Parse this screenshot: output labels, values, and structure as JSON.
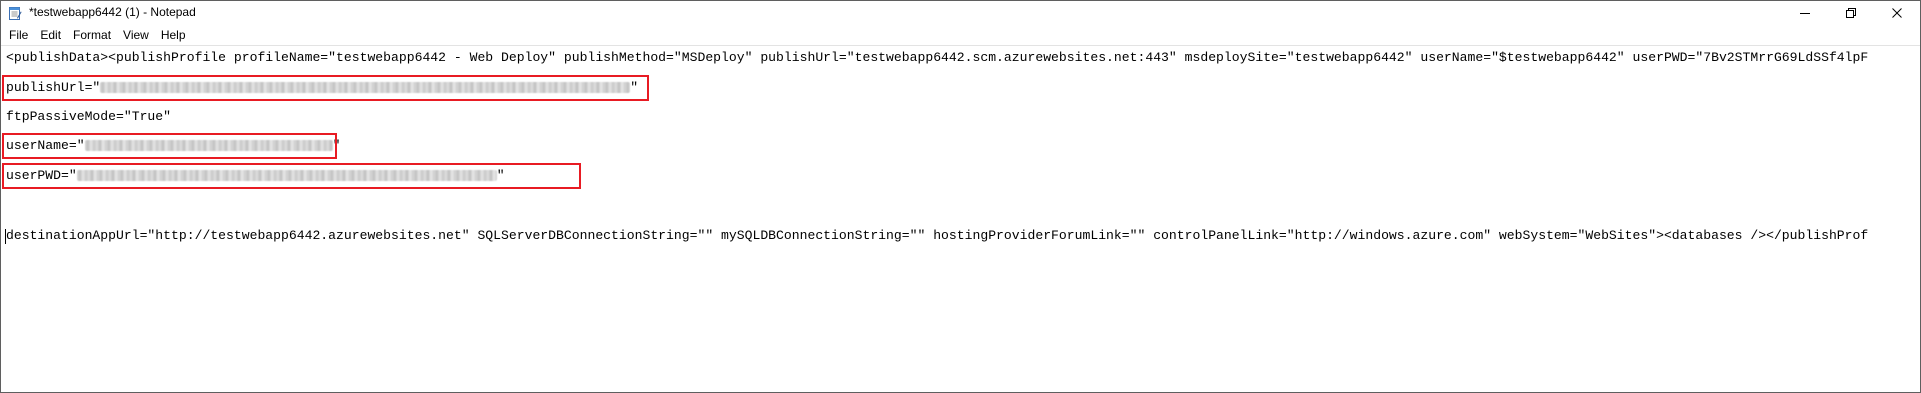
{
  "window": {
    "title": "*testwebapp6442 (1) - Notepad",
    "controls": {
      "minimize": "minimize",
      "maximize": "restore",
      "close": "close"
    }
  },
  "menu": {
    "items": [
      "File",
      "Edit",
      "Format",
      "View",
      "Help"
    ]
  },
  "editor": {
    "line1": "<publishData><publishProfile profileName=\"testwebapp6442 - Web Deploy\" publishMethod=\"MSDeploy\" publishUrl=\"testwebapp6442.scm.azurewebsites.net:443\" msdeploySite=\"testwebapp6442\" userName=\"$testwebapp6442\" userPWD=\"7Bv2STMrrG69LdSSf4lpF",
    "publish_url_prefix": "publishUrl=\"",
    "publish_url_suffix": "\"",
    "ftp_passive": "ftpPassiveMode=\"True\"",
    "username_prefix": "userName=\"",
    "username_suffix": "\"",
    "userpwd_prefix": "userPWD=\"",
    "userpwd_suffix": "\"",
    "last_line": "destinationAppUrl=\"http://testwebapp6442.azurewebsites.net\" SQLServerDBConnectionString=\"\" mySQLDBConnectionString=\"\" hostingProviderForumLink=\"\" controlPanelLink=\"http://windows.azure.com\" webSystem=\"WebSites\"><databases /></publishProf"
  },
  "colors": {
    "highlight_border": "#e81b23",
    "window_border": "#5f5f5f",
    "text": "#000000"
  },
  "icons": {
    "app": "notepad-icon",
    "minimize": "minimize-icon",
    "maximize": "restore-icon",
    "close": "close-icon"
  }
}
